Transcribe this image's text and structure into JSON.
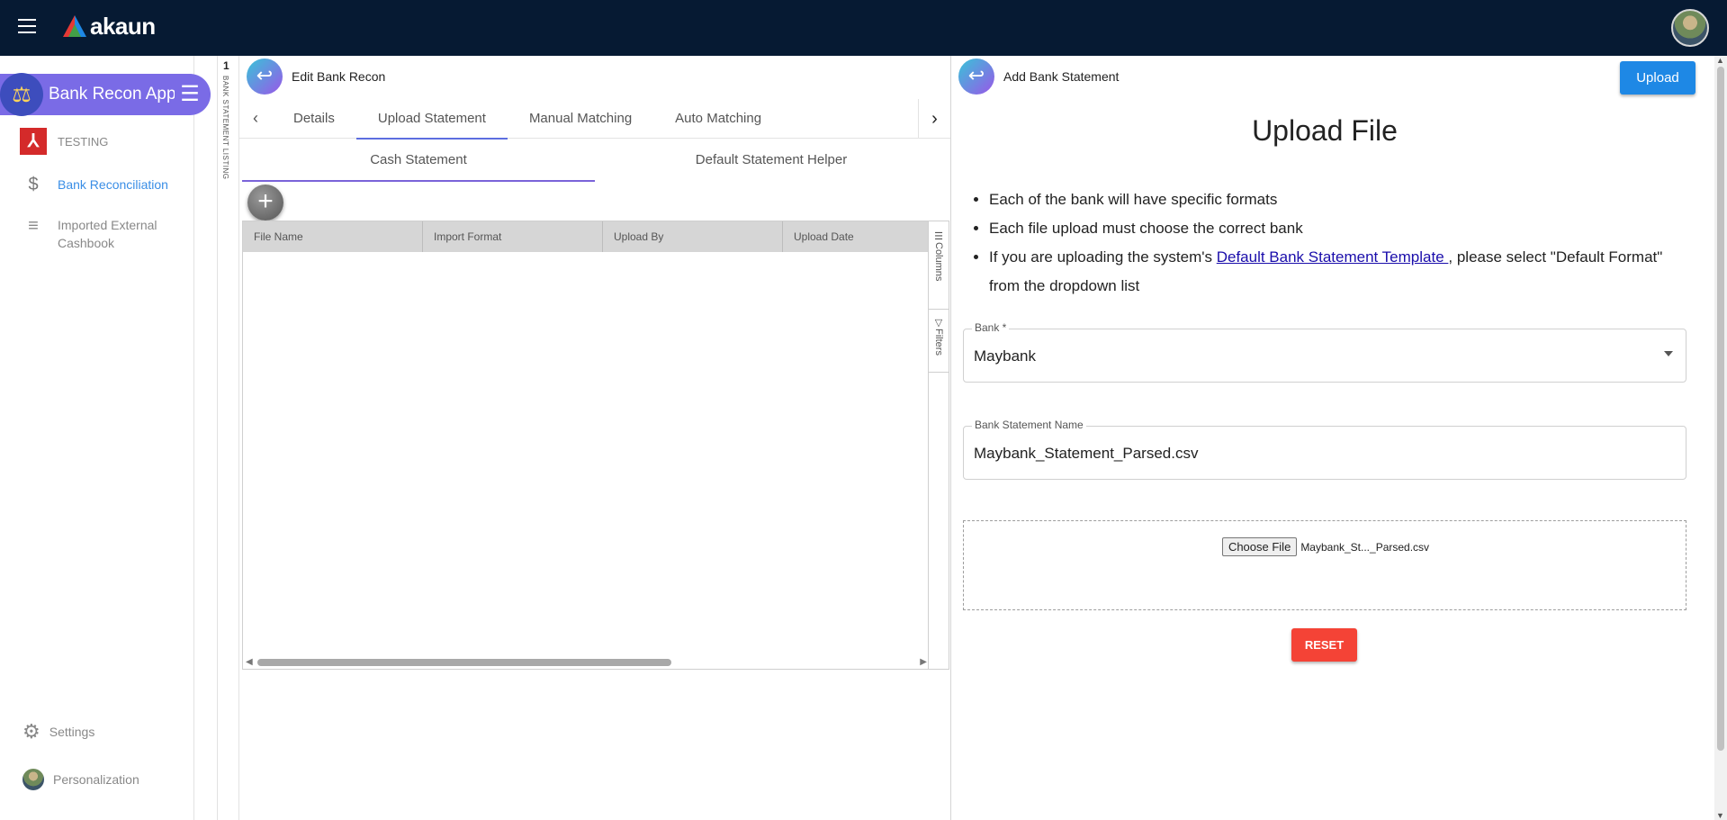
{
  "topbar": {
    "brand": "akaun",
    "menu_icon": "hamburger-icon",
    "avatar_icon": "user-avatar"
  },
  "sidebar": {
    "app_name": "Bank Recon Applet",
    "items": [
      {
        "label": "TESTING",
        "icon": "testing-logo"
      },
      {
        "label": "Bank Reconciliation",
        "icon": "dollar-icon"
      },
      {
        "label": "Imported External Cashbook",
        "icon": "playlist-add-icon"
      }
    ],
    "bottom": [
      {
        "label": "Settings",
        "icon": "gear-icon"
      },
      {
        "label": "Personalization",
        "icon": "user-avatar"
      }
    ]
  },
  "vstrip": {
    "count": "1",
    "label": "BANK STATEMENT LISTING"
  },
  "mid": {
    "title": "Edit Bank Recon",
    "tabs": [
      "Details",
      "Upload Statement",
      "Manual Matching",
      "Auto Matching"
    ],
    "active_tab": "Upload Statement",
    "subtabs": [
      "Cash Statement",
      "Default Statement Helper"
    ],
    "active_subtab": "Cash Statement",
    "grid": {
      "columns": [
        "File Name",
        "Import Format",
        "Upload By",
        "Upload Date"
      ],
      "side_tools": [
        "Columns",
        "Filters"
      ]
    }
  },
  "right": {
    "title": "Add Bank Statement",
    "upload_label": "Upload",
    "heading": "Upload File",
    "rules": {
      "rule1": "Each of the bank will have specific formats",
      "rule2": "Each file upload must choose the correct bank",
      "rule3_prefix": "If you are uploading the system's ",
      "rule3_link": "Default Bank Statement Template ",
      "rule3_suffix": ", please select \"Default Format\" from the dropdown list"
    },
    "bank_field": {
      "label": "Bank *",
      "value": "Maybank"
    },
    "name_field": {
      "label": "Bank Statement Name",
      "value": "Maybank_Statement_Parsed.csv"
    },
    "file": {
      "button": "Choose File",
      "filename": "Maybank_St..._Parsed.csv"
    },
    "reset_label": "RESET"
  }
}
